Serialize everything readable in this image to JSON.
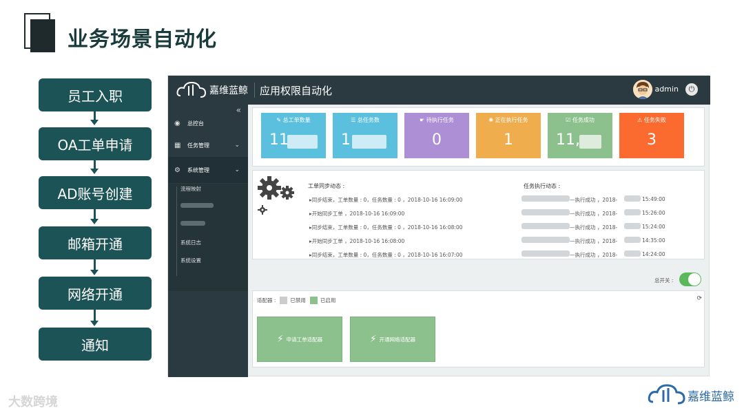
{
  "slide": {
    "title": "业务场景自动化"
  },
  "flow": [
    "员工入职",
    "OA工单申请",
    "AD账号创建",
    "邮箱开通",
    "网络开通",
    "通知"
  ],
  "app": {
    "brand": "嘉维蓝鲸",
    "title": "应用权限自动化",
    "user": "admin",
    "collapse_glyph": "«",
    "nav": [
      {
        "label": "总控台",
        "icon": "dashboard-icon"
      },
      {
        "label": "任务管理",
        "icon": "grid-icon"
      },
      {
        "label": "系统管理",
        "icon": "gears-icon"
      }
    ],
    "subnav": [
      "流程映射",
      "系统日志",
      "系统设置"
    ],
    "stats": [
      {
        "label": "总工单数量",
        "value": "11",
        "color": "#5bc0de",
        "icon": "edit-icon"
      },
      {
        "label": "总任务数",
        "value": "1",
        "color": "#5bc0de",
        "icon": "list-icon"
      },
      {
        "label": "待执行任务",
        "value": "0",
        "color": "#ad8fd6",
        "icon": "hand-icon"
      },
      {
        "label": "正在执行任务",
        "value": "1",
        "color": "#f0ad4e",
        "icon": "spinner-icon"
      },
      {
        "label": "任务成功",
        "value": "11,",
        "color": "#8cc08c",
        "icon": "check-icon"
      },
      {
        "label": "任务失败",
        "value": "3",
        "color": "#fb6b30",
        "icon": "warning-icon"
      }
    ],
    "sync_title": "工单同步动态 :",
    "sync_logs": [
      "▸同步结束，工单数量 : 0，任务数量 : 0 ，2018-10-16 16:09:00",
      "▸开始同步工单 ，2018-10-16 16:09:00",
      "▸同步结束，工单数量 : 0，任务数量 : 0 ，2018-10-16 16:08:00",
      "▸开始同步工单 ，2018-10-16 16:08:00",
      "▸同步结束，工单数量 : 0，任务数量 : 0 ，2018-10-16 16:07:00"
    ],
    "task_title": "任务执行动态 :",
    "task_logs": [
      {
        "text": "—执行成功 ，2018-",
        "time": "15:49:00"
      },
      {
        "text": "—执行成功 ，2018-",
        "time": "15:26:00"
      },
      {
        "text": "—执行成功 ，2018-",
        "time": "15:24:00"
      },
      {
        "text": "—执行成功 ，2018-",
        "time": "14:35:00"
      },
      {
        "text": "—执行成功 ，2018-",
        "time": "14:24:00"
      }
    ],
    "switch_label": "总开关 :",
    "adapter_label": "适配器 :",
    "legend_disabled": "已禁用",
    "legend_enabled": "已启用",
    "adapters": [
      "申请工单适配器",
      "开通网络适配器"
    ],
    "colors": {
      "topbar": "#2a3a40",
      "enabled": "#8cc08c",
      "disabled": "#cccccc"
    }
  },
  "footer": {
    "watermark": "大数跨境",
    "logo_text": "嘉维蓝鲸"
  }
}
